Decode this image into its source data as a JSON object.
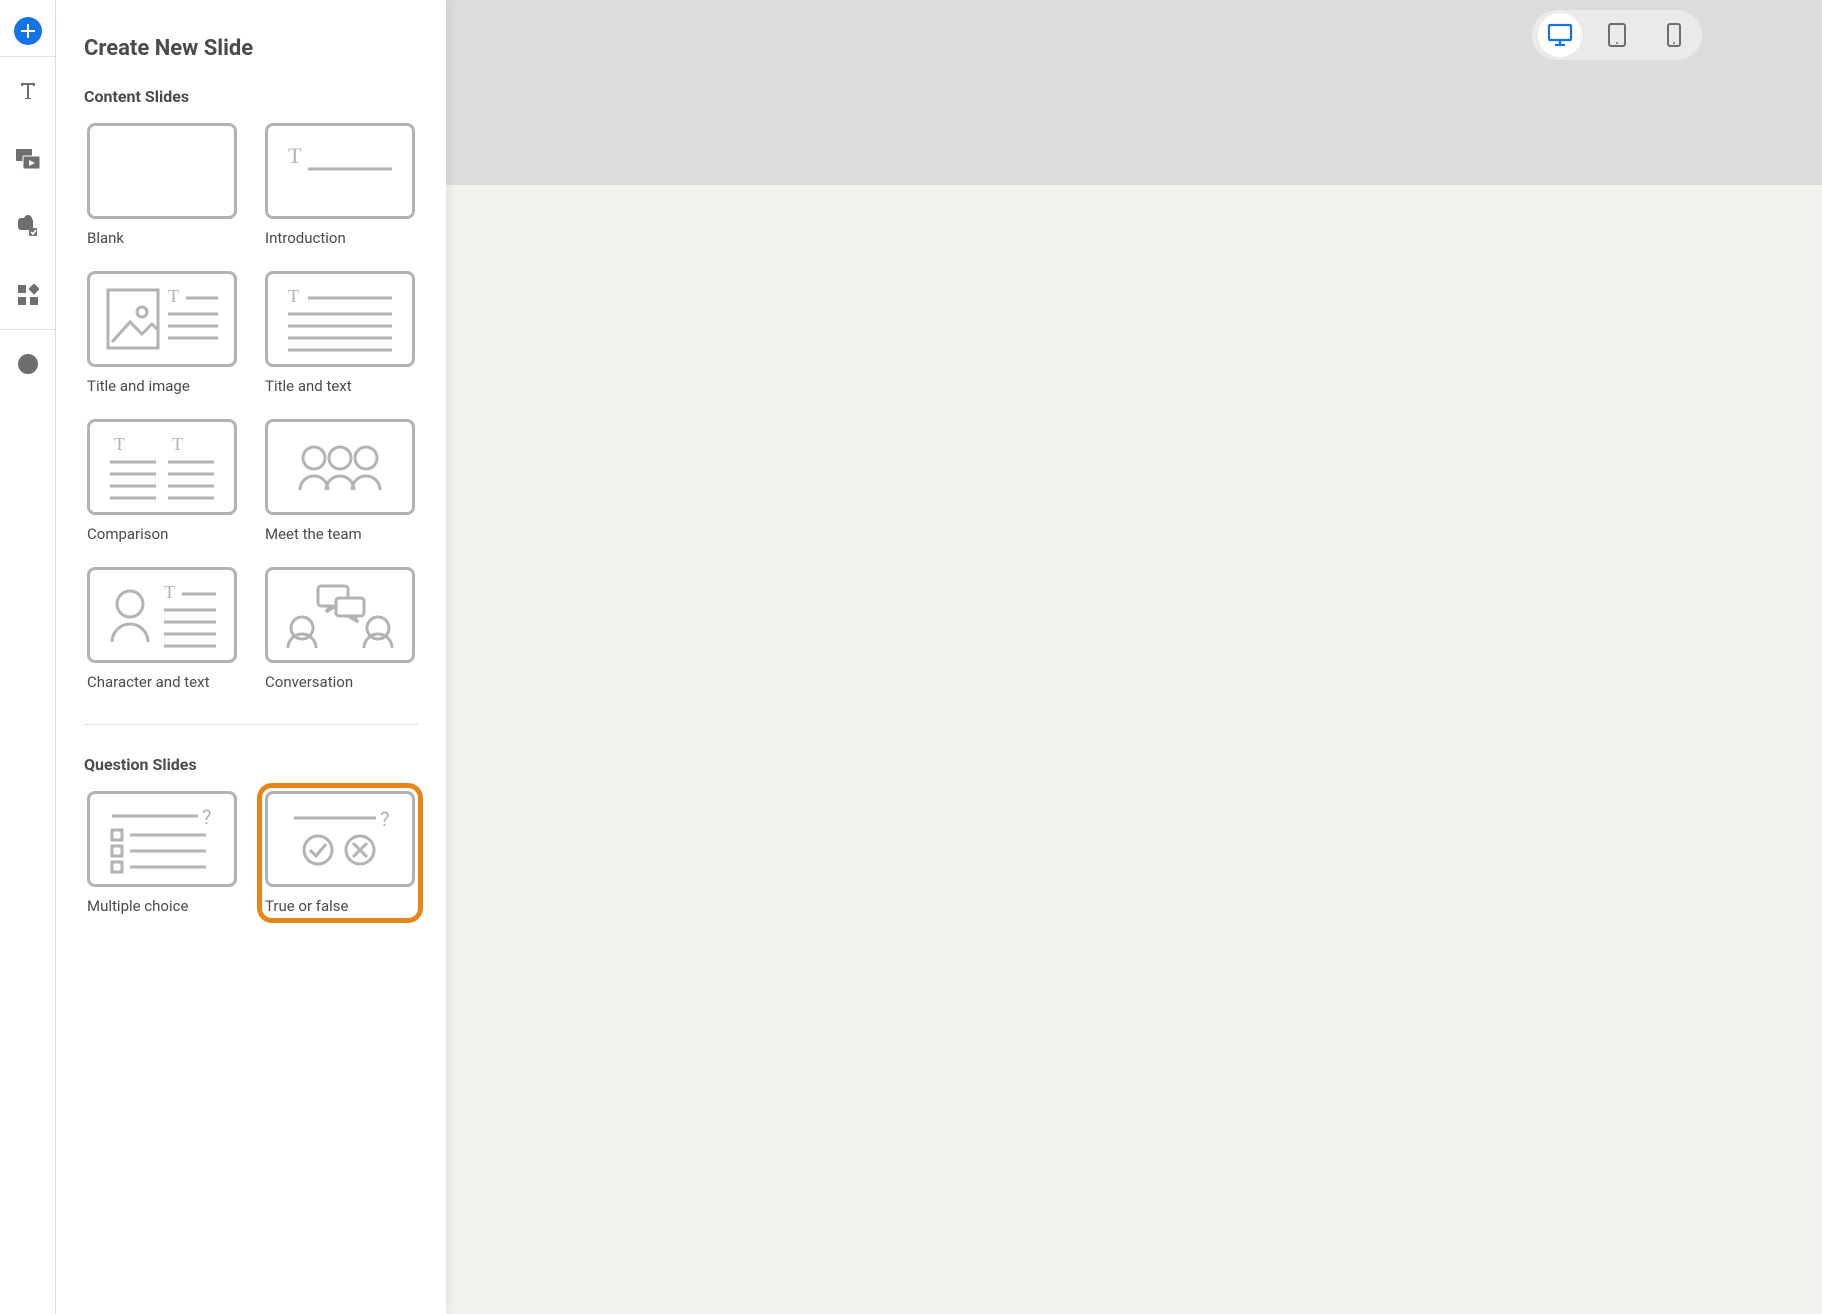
{
  "flyout": {
    "title": "Create New Slide",
    "content_section": "Content Slides",
    "question_section": "Question Slides",
    "options": {
      "blank": "Blank",
      "introduction": "Introduction",
      "title_image": "Title and image",
      "title_text": "Title and text",
      "comparison": "Comparison",
      "meet_team": "Meet the team",
      "character_text": "Character and text",
      "conversation": "Conversation",
      "multiple_choice": "Multiple choice",
      "true_false": "True or false"
    }
  },
  "devices": {
    "desktop": "desktop-view",
    "tablet": "tablet-view",
    "mobile": "mobile-view"
  },
  "rail": {
    "add": "add",
    "text": "text",
    "media": "media",
    "interactive": "interactive",
    "widgets": "widgets",
    "record": "record"
  }
}
